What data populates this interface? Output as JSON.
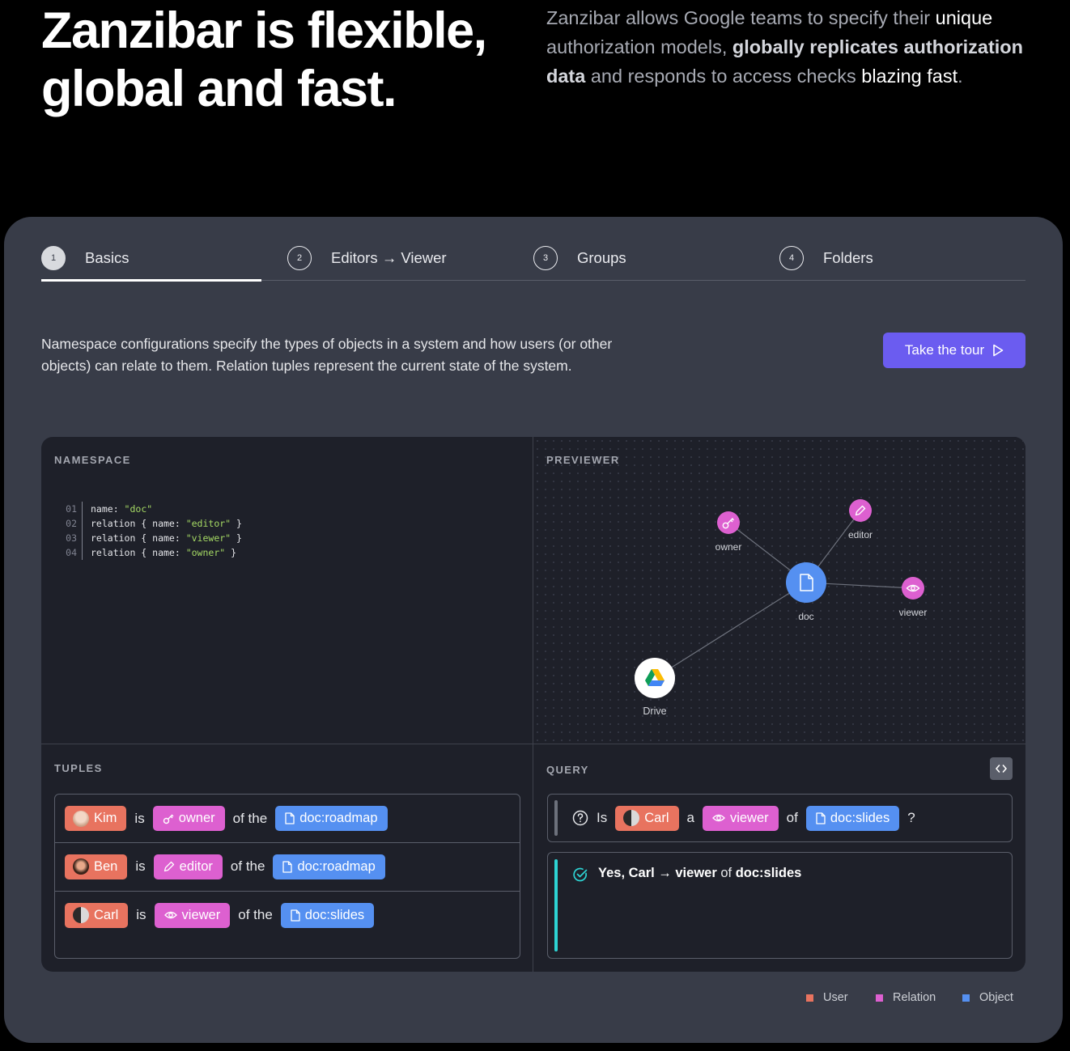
{
  "hero": {
    "title_line1": "Zanzibar is flexible,",
    "title_line2": "global and fast.",
    "desc_1": "Zanzibar allows Google teams to specify their ",
    "desc_2": "unique",
    "desc_3": " authorization models, ",
    "desc_4": "globally replicates authorization data",
    "desc_5": " and responds to access checks ",
    "desc_6": "blazing fast",
    "desc_7": "."
  },
  "tabs": [
    {
      "num": "1",
      "label": "Basics"
    },
    {
      "num": "2",
      "label": "Editors → Viewer"
    },
    {
      "num": "3",
      "label": "Groups"
    },
    {
      "num": "4",
      "label": "Folders"
    }
  ],
  "intro": "Namespace configurations specify the types of objects in a system and how users (or other objects) can relate to them. Relation tuples represent the current state of the system.",
  "tour_button": "Take the tour",
  "namespace": {
    "label": "NAMESPACE",
    "lines": [
      {
        "num": "01",
        "pre": "name: ",
        "str": "\"doc\"",
        "post": ""
      },
      {
        "num": "02",
        "pre": "relation { name: ",
        "str": "\"editor\"",
        "post": " }"
      },
      {
        "num": "03",
        "pre": "relation { name: ",
        "str": "\"viewer\"",
        "post": " }"
      },
      {
        "num": "04",
        "pre": "relation { name: ",
        "str": "\"owner\"",
        "post": " }"
      }
    ]
  },
  "previewer": {
    "label": "PREVIEWER",
    "nodes": {
      "owner": "owner",
      "editor": "editor",
      "doc": "doc",
      "viewer": "viewer",
      "drive": "Drive"
    }
  },
  "tuples": {
    "label": "TUPLES",
    "rows": [
      {
        "user": "Kim",
        "is": "is",
        "relation": "owner",
        "of": "of the",
        "object": "doc:roadmap"
      },
      {
        "user": "Ben",
        "is": "is",
        "relation": "editor",
        "of": "of the",
        "object": "doc:roadmap"
      },
      {
        "user": "Carl",
        "is": "is",
        "relation": "viewer",
        "of": "of the",
        "object": "doc:slides"
      }
    ]
  },
  "query": {
    "label": "QUERY",
    "is": "Is",
    "user": "Carl",
    "a": "a",
    "relation": "viewer",
    "of": "of",
    "object": "doc:slides",
    "q": "?",
    "result_prefix": "Yes, Carl → viewer",
    "result_of": "of",
    "result_object": "doc:slides"
  },
  "legend": [
    {
      "label": "User",
      "color": "#e8735f"
    },
    {
      "label": "Relation",
      "color": "#dd60d0"
    },
    {
      "label": "Object",
      "color": "#5590f1"
    }
  ],
  "colors": {
    "user": "#e8735f",
    "relation": "#dd60d0",
    "object": "#5590f1",
    "accent": "#6b5cf0",
    "success": "#2dd4d4"
  }
}
